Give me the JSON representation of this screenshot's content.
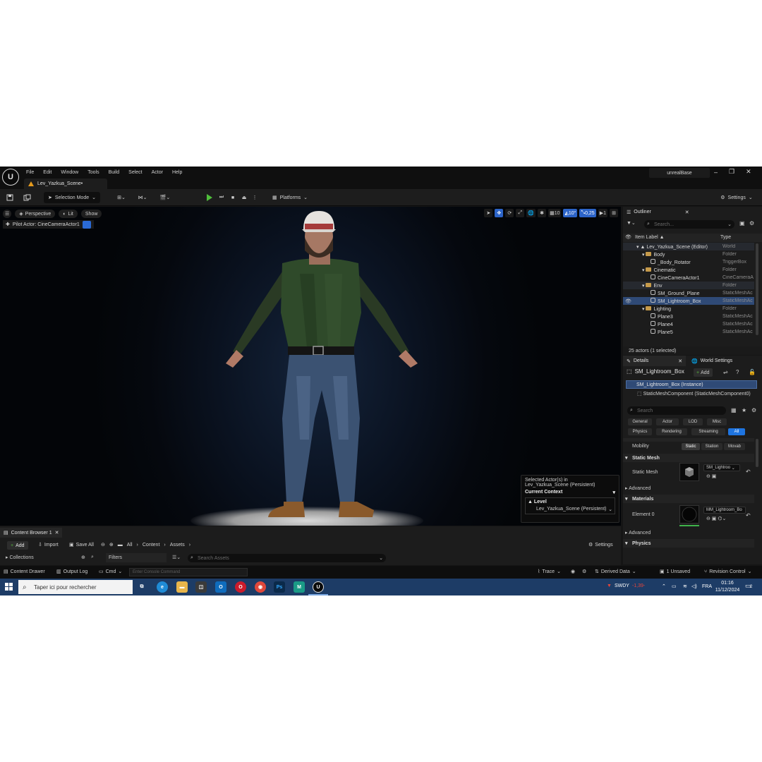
{
  "app": {
    "menus": [
      "File",
      "Edit",
      "Window",
      "Tools",
      "Build",
      "Select",
      "Actor",
      "Help"
    ],
    "doc_tab": "Lev_Yazkua_Scene•",
    "project_name": "unrealBase",
    "logo_text": "U"
  },
  "toolbar": {
    "selection_mode": "Selection Mode",
    "platforms": "Platforms",
    "settings": "Settings"
  },
  "viewport": {
    "view_mode": "Perspective",
    "lighting": "Lit",
    "show": "Show",
    "pilot": "Pilot Actor: CineCameraActor1",
    "grid_snap": "10",
    "rot_snap": "10°",
    "scale_snap": "0,25",
    "camera_speed": "1",
    "context": {
      "selected_line1": "Selected Actor(s) in",
      "selected_line2": "Lev_Yazkua_Scene (Persistent)",
      "current_context": "Current Context",
      "level_label": "Level",
      "level_value": "Lev_Yazkua_Scene (Persistent)"
    }
  },
  "outliner": {
    "tab": "Outliner",
    "search_placeholder": "Search...",
    "col_label": "Item Label ▲",
    "col_type": "Type",
    "rows": [
      {
        "name": "Lev_Yazkua_Scene (Editor)",
        "type": "World"
      },
      {
        "name": "Body",
        "type": "Folder"
      },
      {
        "name": "_Body_Rotator",
        "type": "TriggerBox"
      },
      {
        "name": "Cinematic",
        "type": "Folder"
      },
      {
        "name": "CineCameraActor1",
        "type": "CineCameraA"
      },
      {
        "name": "Env",
        "type": "Folder"
      },
      {
        "name": "SM_Ground_Plane",
        "type": "StaticMeshAc"
      },
      {
        "name": "SM_Lightroom_Box",
        "type": "StaticMeshAc"
      },
      {
        "name": "Lighting",
        "type": "Folder"
      },
      {
        "name": "Plane3",
        "type": "StaticMeshAc"
      },
      {
        "name": "Plane4",
        "type": "StaticMeshAc"
      },
      {
        "name": "Plane5",
        "type": "StaticMeshAc"
      }
    ],
    "footer": "25 actors (1 selected)"
  },
  "details": {
    "tab": "Details",
    "world_tab": "World Settings",
    "object_name": "SM_Lightroom_Box",
    "add": "Add",
    "instance": "SM_Lightroom_Box (Instance)",
    "component": "StaticMeshComponent (StaticMeshComponent0)",
    "search_placeholder": "Search",
    "categories_row1": [
      "General",
      "Actor",
      "LOD",
      "Misc"
    ],
    "categories_row2": [
      "Physics",
      "Rendering",
      "Streaming",
      "All"
    ],
    "mobility_label": "Mobility",
    "mobility_options": [
      "Static",
      "Station",
      "Movab"
    ],
    "static_mesh_section": "Static Mesh",
    "static_mesh_label": "Static Mesh",
    "static_mesh_value": "SM_Lightroo",
    "advanced": "Advanced",
    "materials_section": "Materials",
    "element0_label": "Element 0",
    "element0_value": "MM_Lightroom_Bo",
    "advanced2": "Advanced",
    "physics_section": "Physics"
  },
  "content_browser": {
    "tab": "Content Browser 1",
    "add": "Add",
    "import": "Import",
    "save_all": "Save All",
    "path": [
      "All",
      "Content",
      "Assets"
    ],
    "settings": "Settings",
    "collections": "Collections",
    "filters": "Filters",
    "search_placeholder": "Search Assets"
  },
  "statusbar": {
    "content_drawer": "Content Drawer",
    "output_log": "Output Log",
    "cmd": "Cmd",
    "console_placeholder": "Enter Console Command",
    "trace": "Trace",
    "derived_data": "Derived Data",
    "unsaved": "1 Unsaved",
    "revision_control": "Revision Control"
  },
  "taskbar": {
    "search_placeholder": "Taper ici pour rechercher",
    "stock_name": "SWDY",
    "stock_change": "-1,39-",
    "lang": "FRA",
    "time": "01:16",
    "date": "11/12/2024",
    "notif_count": "2"
  }
}
